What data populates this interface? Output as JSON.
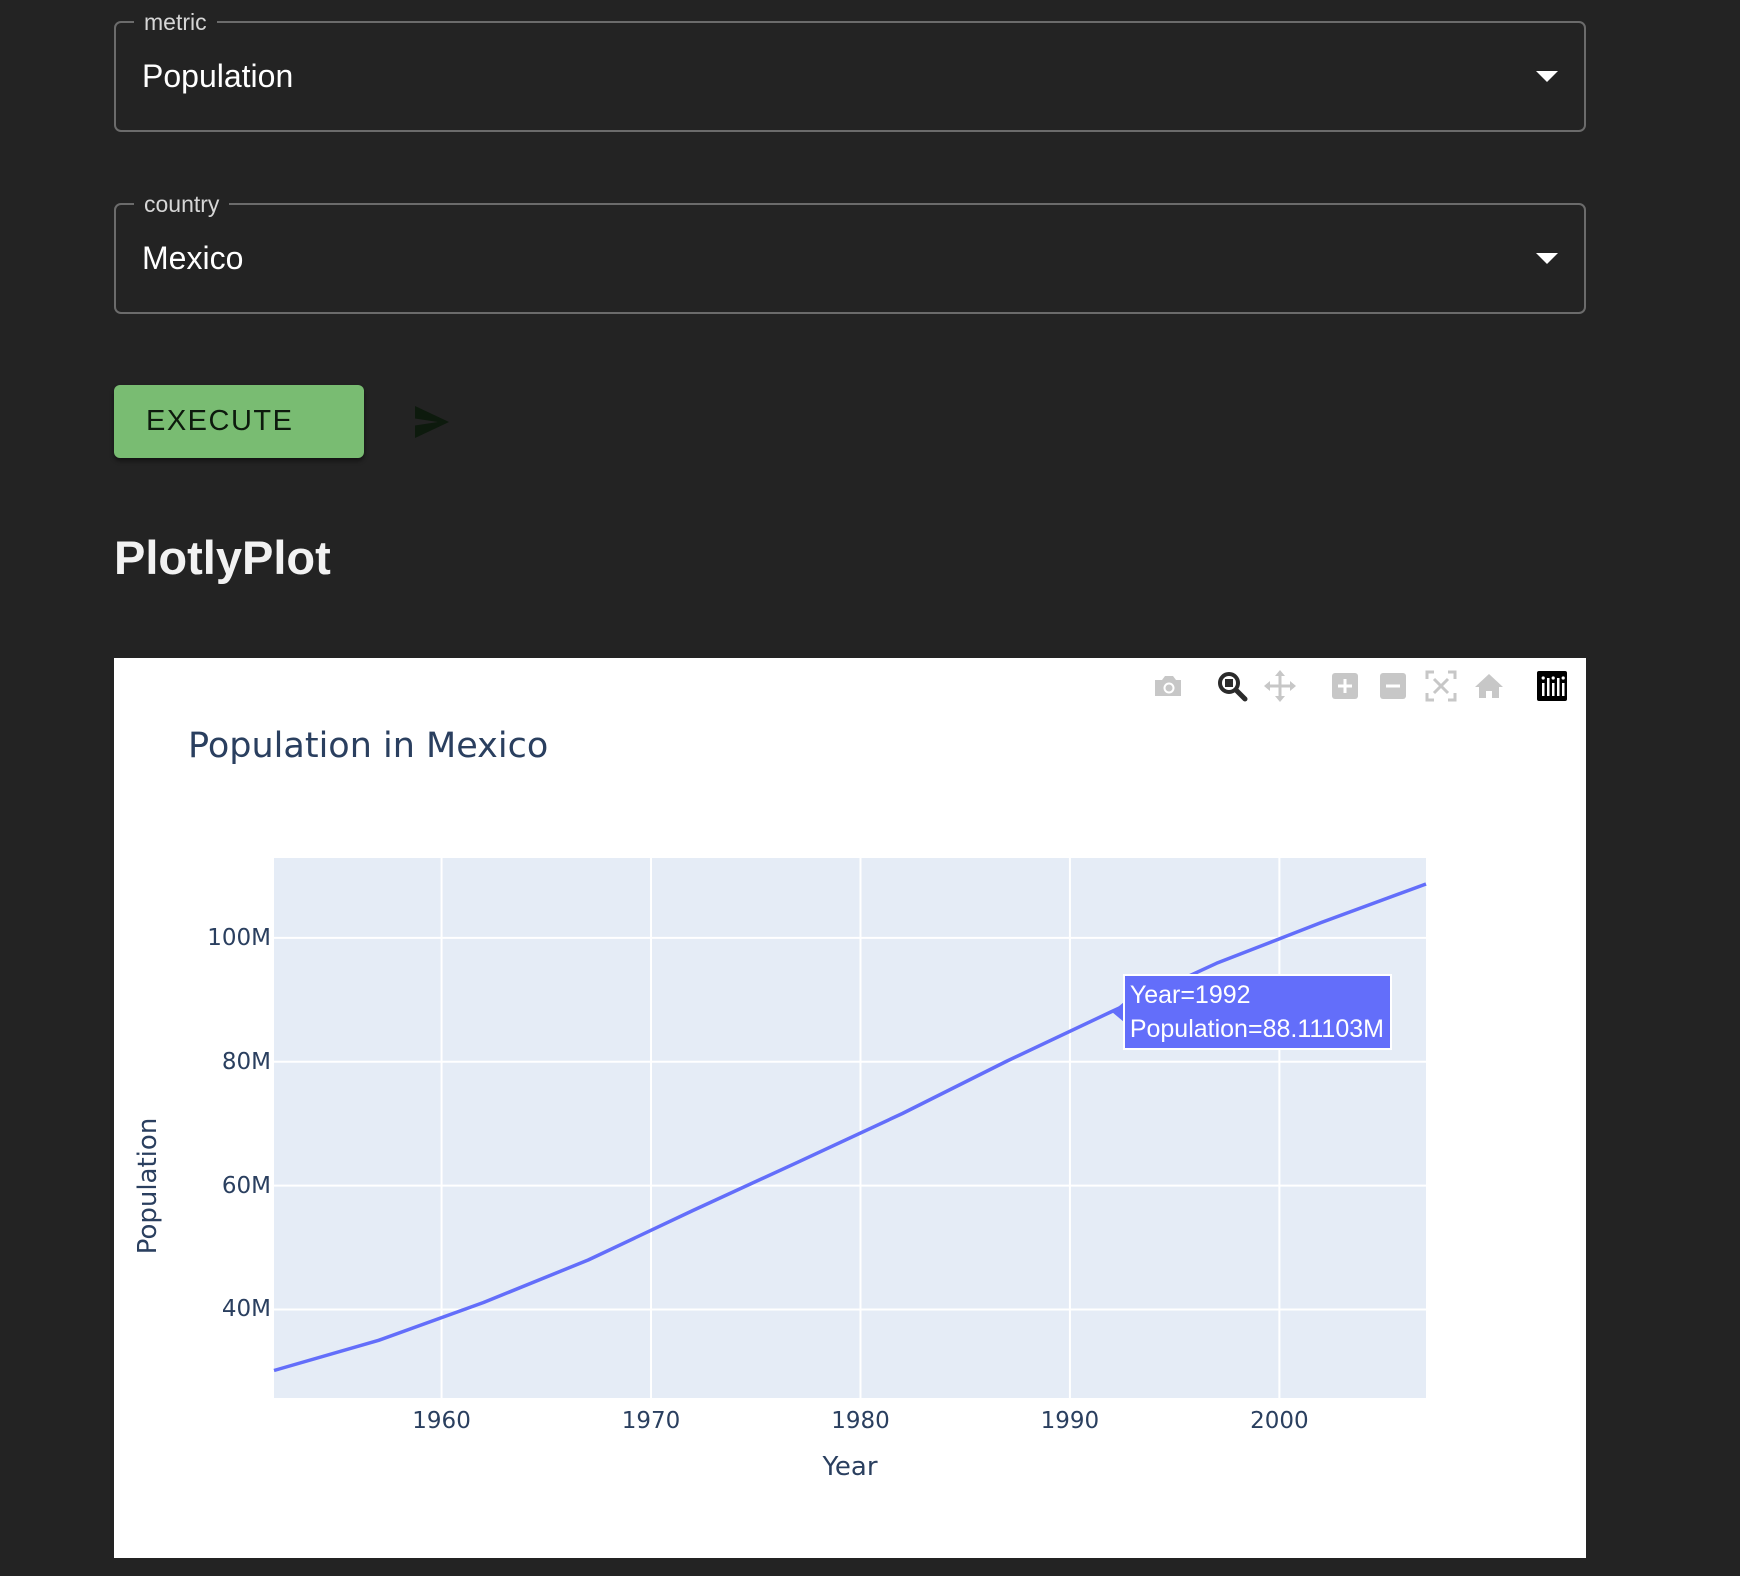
{
  "form": {
    "metric": {
      "label": "metric",
      "value": "Population"
    },
    "country": {
      "label": "country",
      "value": "Mexico"
    },
    "execute_label": "EXECUTE"
  },
  "section_heading": "PlotlyPlot",
  "modebar": {
    "icons": [
      "camera-icon",
      "zoom-icon",
      "pan-icon",
      "zoom-in-icon",
      "zoom-out-icon",
      "autoscale-icon",
      "home-icon",
      "plotly-logo-icon"
    ]
  },
  "colors": {
    "background": "#232323",
    "execute_button": "#79bc72",
    "plot_area": "#e5ecf6",
    "line": "#636efa",
    "text": "#2a3f5f"
  },
  "hover": {
    "line1": "Year=1992",
    "line2": "Population=88.11103M",
    "year": 1992,
    "value": 88.11103
  },
  "chart_data": {
    "type": "line",
    "title": "Population in Mexico",
    "xlabel": "Year",
    "ylabel": "Population",
    "x": [
      1952,
      1957,
      1962,
      1967,
      1972,
      1977,
      1982,
      1987,
      1992,
      1997,
      2002,
      2007
    ],
    "series": [
      {
        "values": [
          30.14,
          35.02,
          41.12,
          47.99,
          55.98,
          63.76,
          71.64,
          80.12,
          88.11,
          95.9,
          102.48,
          108.7
        ]
      }
    ],
    "xlim": [
      1952,
      2007
    ],
    "ylim": [
      25.7,
      112.9
    ],
    "xticks": [
      1960,
      1970,
      1980,
      1990,
      2000
    ],
    "xtick_labels": [
      "1960",
      "1970",
      "1980",
      "1990",
      "2000"
    ],
    "yticks": [
      40,
      60,
      80,
      100
    ],
    "ytick_labels": [
      "40M",
      "60M",
      "80M",
      "100M"
    ],
    "grid": true
  }
}
